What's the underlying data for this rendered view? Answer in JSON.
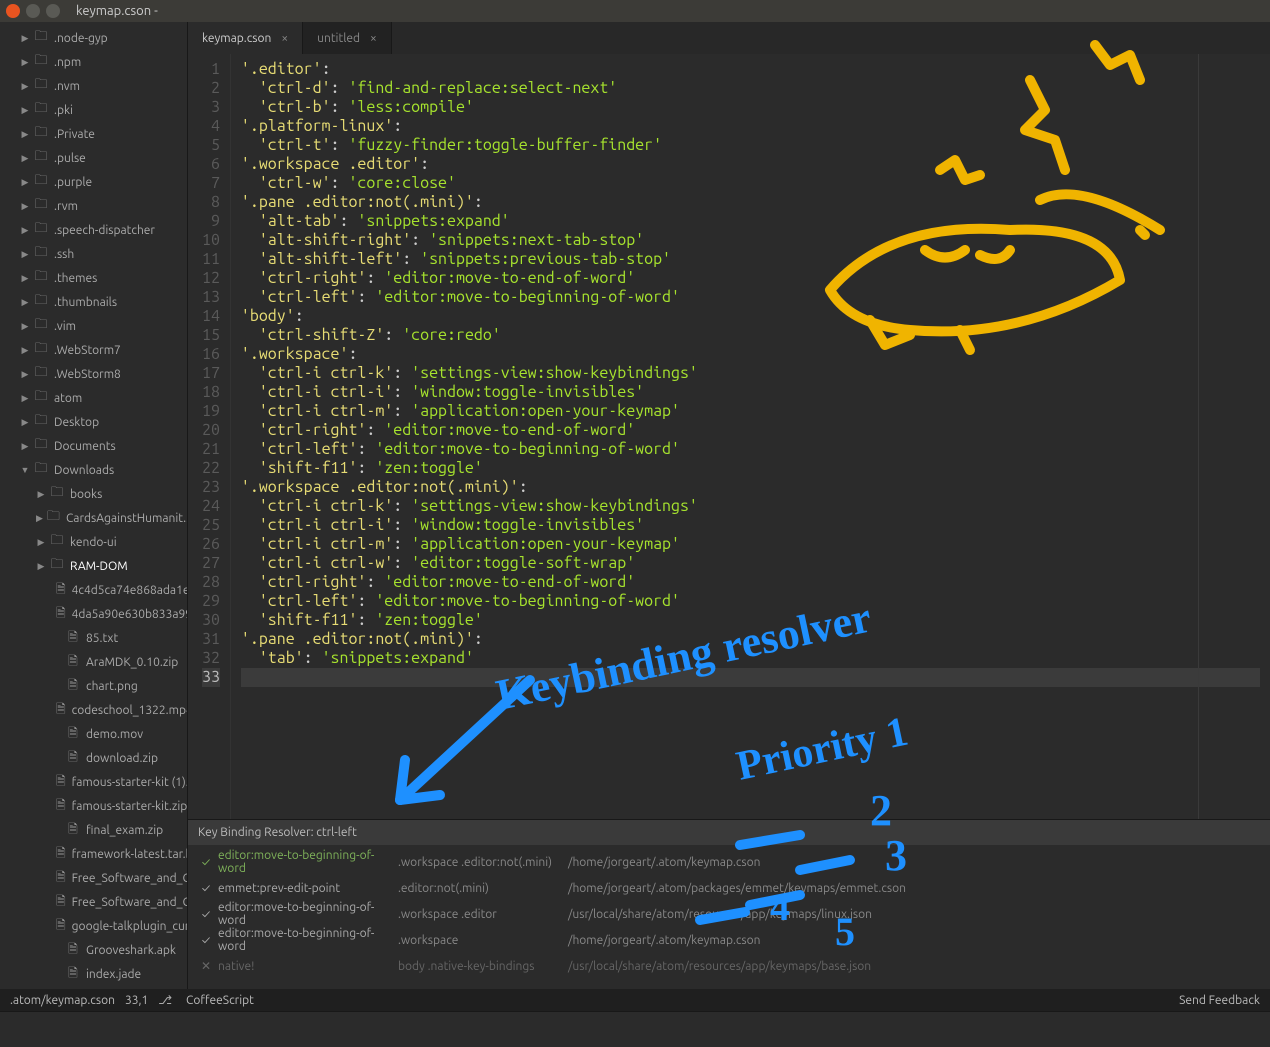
{
  "window": {
    "title": "keymap.cson -"
  },
  "tabs": [
    {
      "label": "keymap.cson",
      "active": true
    },
    {
      "label": "untitled",
      "active": false
    }
  ],
  "tree": [
    {
      "label": ".node-gyp",
      "level": 1,
      "kind": "folder",
      "arrow": "▶"
    },
    {
      "label": ".npm",
      "level": 1,
      "kind": "folder",
      "arrow": "▶"
    },
    {
      "label": ".nvm",
      "level": 1,
      "kind": "folder",
      "arrow": "▶"
    },
    {
      "label": ".pki",
      "level": 1,
      "kind": "folder",
      "arrow": "▶"
    },
    {
      "label": ".Private",
      "level": 1,
      "kind": "folder",
      "arrow": "▶"
    },
    {
      "label": ".pulse",
      "level": 1,
      "kind": "folder",
      "arrow": "▶"
    },
    {
      "label": ".purple",
      "level": 1,
      "kind": "folder",
      "arrow": "▶"
    },
    {
      "label": ".rvm",
      "level": 1,
      "kind": "folder",
      "arrow": "▶"
    },
    {
      "label": ".speech-dispatcher",
      "level": 1,
      "kind": "folder",
      "arrow": "▶"
    },
    {
      "label": ".ssh",
      "level": 1,
      "kind": "folder",
      "arrow": "▶"
    },
    {
      "label": ".themes",
      "level": 1,
      "kind": "folder",
      "arrow": "▶"
    },
    {
      "label": ".thumbnails",
      "level": 1,
      "kind": "folder",
      "arrow": "▶"
    },
    {
      "label": ".vim",
      "level": 1,
      "kind": "folder",
      "arrow": "▶"
    },
    {
      "label": ".WebStorm7",
      "level": 1,
      "kind": "folder",
      "arrow": "▶"
    },
    {
      "label": ".WebStorm8",
      "level": 1,
      "kind": "folder",
      "arrow": "▶"
    },
    {
      "label": "atom",
      "level": 1,
      "kind": "folder",
      "arrow": "▶"
    },
    {
      "label": "Desktop",
      "level": 1,
      "kind": "folder",
      "arrow": "▶"
    },
    {
      "label": "Documents",
      "level": 1,
      "kind": "folder",
      "arrow": "▶"
    },
    {
      "label": "Downloads",
      "level": 1,
      "kind": "folder",
      "arrow": "▼",
      "expanded": true
    },
    {
      "label": "books",
      "level": 2,
      "kind": "folder",
      "arrow": "▶"
    },
    {
      "label": "CardsAgainstHumanit...",
      "level": 2,
      "kind": "folder",
      "arrow": "▶"
    },
    {
      "label": "kendo-ui",
      "level": 2,
      "kind": "folder",
      "arrow": "▶"
    },
    {
      "label": "RAM-DOM",
      "level": 2,
      "kind": "folder",
      "arrow": "▶",
      "selected": true
    },
    {
      "label": "4c4d5ca74e868ada1e",
      "level": 3,
      "kind": "file"
    },
    {
      "label": "4da5a90e630b833a99",
      "level": 3,
      "kind": "file"
    },
    {
      "label": "85.txt",
      "level": 3,
      "kind": "file"
    },
    {
      "label": "AraMDK_0.10.zip",
      "level": 3,
      "kind": "file"
    },
    {
      "label": "chart.png",
      "level": 3,
      "kind": "file"
    },
    {
      "label": "codeschool_1322.mp4",
      "level": 3,
      "kind": "file"
    },
    {
      "label": "demo.mov",
      "level": 3,
      "kind": "file"
    },
    {
      "label": "download.zip",
      "level": 3,
      "kind": "file"
    },
    {
      "label": "famous-starter-kit (1).",
      "level": 3,
      "kind": "file"
    },
    {
      "label": "famous-starter-kit.zip",
      "level": 3,
      "kind": "file"
    },
    {
      "label": "final_exam.zip",
      "level": 3,
      "kind": "file"
    },
    {
      "label": "framework-latest.tar.b",
      "level": 3,
      "kind": "file"
    },
    {
      "label": "Free_Software_and_C",
      "level": 3,
      "kind": "file"
    },
    {
      "label": "Free_Software_and_C",
      "level": 3,
      "kind": "file"
    },
    {
      "label": "google-talkplugin_curr",
      "level": 3,
      "kind": "file"
    },
    {
      "label": "Grooveshark.apk",
      "level": 3,
      "kind": "file"
    },
    {
      "label": "index.jade",
      "level": 3,
      "kind": "file"
    }
  ],
  "code_lines": [
    {
      "n": 1,
      "key": "'.editor'",
      "val": "",
      "col": ":"
    },
    {
      "n": 2,
      "indent": 2,
      "key": "'ctrl-d'",
      "val": "'find-and-replace:select-next'"
    },
    {
      "n": 3,
      "indent": 2,
      "key": "'ctrl-b'",
      "val": "'less:compile'"
    },
    {
      "n": 4,
      "key": "'.platform-linux'",
      "val": "",
      "col": ":"
    },
    {
      "n": 5,
      "indent": 2,
      "key": "'ctrl-t'",
      "val": "'fuzzy-finder:toggle-buffer-finder'"
    },
    {
      "n": 6,
      "key": "'.workspace .editor'",
      "val": "",
      "col": ":"
    },
    {
      "n": 7,
      "indent": 2,
      "key": "'ctrl-w'",
      "val": "'core:close'"
    },
    {
      "n": 8,
      "key": "'.pane .editor:not(.mini)'",
      "val": "",
      "col": ":"
    },
    {
      "n": 9,
      "indent": 2,
      "key": "'alt-tab'",
      "val": "'snippets:expand'"
    },
    {
      "n": 10,
      "indent": 2,
      "key": "'alt-shift-right'",
      "val": "'snippets:next-tab-stop'"
    },
    {
      "n": 11,
      "indent": 2,
      "key": "'alt-shift-left'",
      "val": "'snippets:previous-tab-stop'"
    },
    {
      "n": 12,
      "indent": 2,
      "key": "'ctrl-right'",
      "val": "'editor:move-to-end-of-word'"
    },
    {
      "n": 13,
      "indent": 2,
      "key": "'ctrl-left'",
      "val": "'editor:move-to-beginning-of-word'"
    },
    {
      "n": 14,
      "key": "'body'",
      "val": "",
      "col": ":"
    },
    {
      "n": 15,
      "indent": 2,
      "key": "'ctrl-shift-Z'",
      "val": "'core:redo'"
    },
    {
      "n": 16,
      "key": "'.workspace'",
      "val": "",
      "col": ":"
    },
    {
      "n": 17,
      "indent": 2,
      "key": "'ctrl-i ctrl-k'",
      "val": "'settings-view:show-keybindings'"
    },
    {
      "n": 18,
      "indent": 2,
      "key": "'ctrl-i ctrl-i'",
      "val": "'window:toggle-invisibles'"
    },
    {
      "n": 19,
      "indent": 2,
      "key": "'ctrl-i ctrl-m'",
      "val": "'application:open-your-keymap'"
    },
    {
      "n": 20,
      "indent": 2,
      "key": "'ctrl-right'",
      "val": "'editor:move-to-end-of-word'"
    },
    {
      "n": 21,
      "indent": 2,
      "key": "'ctrl-left'",
      "val": "'editor:move-to-beginning-of-word'"
    },
    {
      "n": 22,
      "indent": 2,
      "key": "'shift-f11'",
      "val": "'zen:toggle'"
    },
    {
      "n": 23,
      "key": "'.workspace .editor:not(.mini)'",
      "val": "",
      "col": ":"
    },
    {
      "n": 24,
      "indent": 2,
      "key": "'ctrl-i ctrl-k'",
      "val": "'settings-view:show-keybindings'"
    },
    {
      "n": 25,
      "indent": 2,
      "key": "'ctrl-i ctrl-i'",
      "val": "'window:toggle-invisibles'"
    },
    {
      "n": 26,
      "indent": 2,
      "key": "'ctrl-i ctrl-m'",
      "val": "'application:open-your-keymap'"
    },
    {
      "n": 27,
      "indent": 2,
      "key": "'ctrl-i ctrl-w'",
      "val": "'editor:toggle-soft-wrap'"
    },
    {
      "n": 28,
      "indent": 2,
      "key": "'ctrl-right'",
      "val": "'editor:move-to-end-of-word'"
    },
    {
      "n": 29,
      "indent": 2,
      "key": "'ctrl-left'",
      "val": "'editor:move-to-beginning-of-word'"
    },
    {
      "n": 30,
      "indent": 2,
      "key": "'shift-f11'",
      "val": "'zen:toggle'"
    },
    {
      "n": 31,
      "key": "'.pane .editor:not(.mini)'",
      "val": "",
      "col": ":"
    },
    {
      "n": 32,
      "indent": 2,
      "key": "'tab'",
      "val": "'snippets:expand'"
    },
    {
      "n": 33,
      "key": "",
      "val": "",
      "hl": true
    }
  ],
  "resolver": {
    "title": "Key Binding Resolver: ctrl-left",
    "rows": [
      {
        "mark": "✓",
        "active": true,
        "cmd": "editor:move-to-beginning-of-word",
        "sel": ".workspace .editor:not(.mini)",
        "src": "/home/jorgeart/.atom/keymap.cson"
      },
      {
        "mark": "✓",
        "cmd": "emmet:prev-edit-point",
        "sel": ".editor:not(.mini)",
        "src": "/home/jorgeart/.atom/packages/emmet/keymaps/emmet.cson"
      },
      {
        "mark": "✓",
        "cmd": "editor:move-to-beginning-of-word",
        "sel": ".workspace .editor",
        "src": "/usr/local/share/atom/resources/app/keymaps/linux.json"
      },
      {
        "mark": "✓",
        "cmd": "editor:move-to-beginning-of-word",
        "sel": ".workspace",
        "src": "/home/jorgeart/.atom/keymap.cson"
      },
      {
        "mark": "✕",
        "dim": true,
        "cmd": "native!",
        "sel": "body .native-key-bindings",
        "src": "/usr/local/share/atom/resources/app/keymaps/base.json"
      }
    ]
  },
  "status": {
    "path": ".atom/keymap.cson",
    "cursor": "33,1",
    "lang": "CoffeeScript",
    "feedback": "Send Feedback"
  }
}
